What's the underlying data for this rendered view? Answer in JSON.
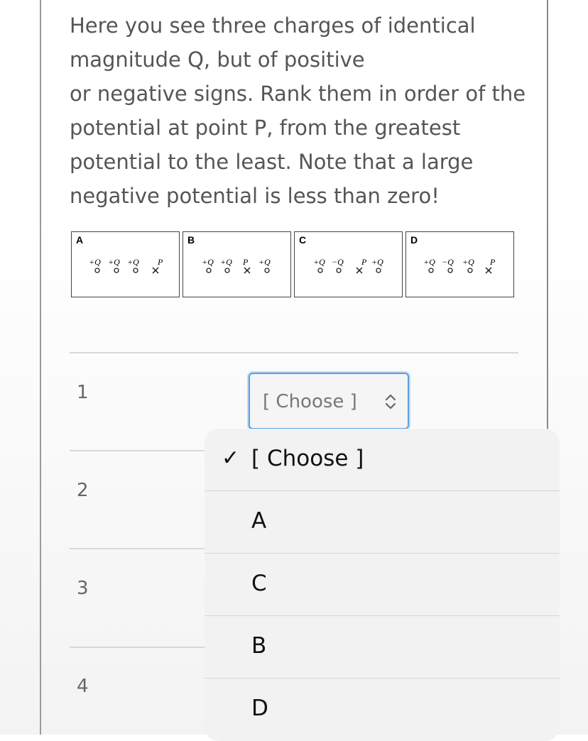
{
  "question": {
    "lines": [
      "Here you see three charges of identical",
      "magnitude Q, but of positive",
      "or negative signs.  Rank them in order of the",
      "potential at point P, from the greatest",
      "potential to the least.  Note that a large",
      "negative potential is less than zero!"
    ]
  },
  "figures": [
    {
      "label": "A",
      "marks": [
        "+Q",
        "+Q",
        "+Q",
        "P"
      ]
    },
    {
      "label": "B",
      "marks": [
        "+Q",
        "+Q",
        "P",
        "+Q"
      ]
    },
    {
      "label": "C",
      "marks": [
        "+Q",
        "−Q",
        "P",
        "+Q"
      ]
    },
    {
      "label": "D",
      "marks": [
        "+Q",
        "−Q",
        "+Q",
        "P"
      ]
    }
  ],
  "rows": [
    "1",
    "2",
    "3",
    "4"
  ],
  "select": {
    "value": "[ Choose ]"
  },
  "dropdown": {
    "options": [
      {
        "label": "[ Choose ]",
        "checked": true
      },
      {
        "label": "A",
        "checked": false
      },
      {
        "label": "C",
        "checked": false
      },
      {
        "label": "B",
        "checked": false
      },
      {
        "label": "D",
        "checked": false
      }
    ],
    "check_glyph": "✓"
  },
  "colors": {
    "focus": "#5aa0e6",
    "text": "#555555"
  }
}
